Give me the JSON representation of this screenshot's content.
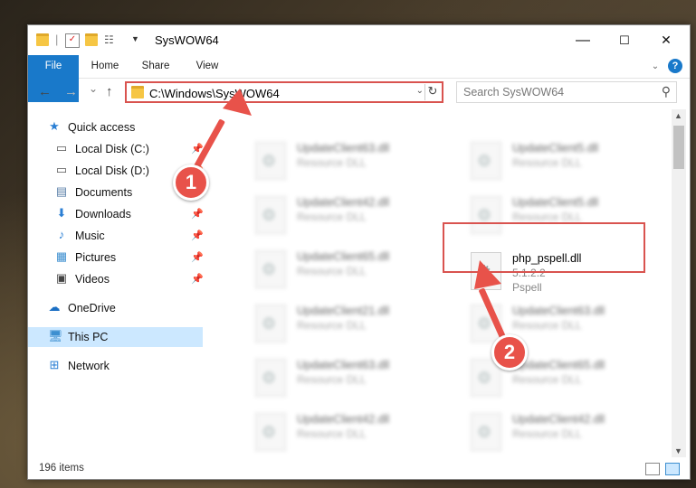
{
  "window": {
    "title": "SysWOW64",
    "minimize": "—",
    "maximize": "☐",
    "close": "✕"
  },
  "ribbon": {
    "tabs": [
      "File",
      "Home",
      "Share",
      "View"
    ],
    "help": "?"
  },
  "nav": {
    "back": "←",
    "forward": "→",
    "recent": "⌄",
    "up": "↑",
    "address": "C:\\Windows\\SysWOW64",
    "refresh": "↻",
    "search_placeholder": "Search SysWOW64",
    "search_icon": "⚲"
  },
  "sidebar": {
    "items": [
      {
        "label": "Quick access",
        "icon": "star-icon",
        "glyph": "★",
        "color": "#2b7fd4",
        "pinned": false
      },
      {
        "label": "Local Disk (C:)",
        "icon": "drive-icon",
        "glyph": "▭",
        "color": "#555",
        "pinned": true
      },
      {
        "label": "Local Disk (D:)",
        "icon": "drive-icon",
        "glyph": "▭",
        "color": "#555",
        "pinned": true
      },
      {
        "label": "Documents",
        "icon": "document-icon",
        "glyph": "▤",
        "color": "#5a7fa8",
        "pinned": true
      },
      {
        "label": "Downloads",
        "icon": "download-icon",
        "glyph": "⬇",
        "color": "#2b7fd4",
        "pinned": true
      },
      {
        "label": "Music",
        "icon": "music-icon",
        "glyph": "♪",
        "color": "#2b7fd4",
        "pinned": true
      },
      {
        "label": "Pictures",
        "icon": "pictures-icon",
        "glyph": "▦",
        "color": "#3d8fd0",
        "pinned": true
      },
      {
        "label": "Videos",
        "icon": "video-icon",
        "glyph": "▣",
        "color": "#444",
        "pinned": true
      },
      {
        "label": "OneDrive",
        "icon": "cloud-icon",
        "glyph": "☁",
        "color": "#1b6fc4",
        "pinned": false
      },
      {
        "label": "This PC",
        "icon": "computer-icon",
        "glyph": "🖥",
        "color": "#3d8fd0",
        "pinned": false
      },
      {
        "label": "Network",
        "icon": "network-icon",
        "glyph": "⊞",
        "color": "#2b7fd4",
        "pinned": false
      }
    ],
    "pin_glyph": "📌"
  },
  "files": {
    "left": [
      {
        "name": "UpdateClient63.dll",
        "type": "Resource DLL"
      },
      {
        "name": "UpdateClient42.dll",
        "type": "Resource DLL"
      },
      {
        "name": "UpdateClient65.dll",
        "type": "Resource DLL"
      },
      {
        "name": "UpdateClient21.dll",
        "type": "Resource DLL"
      },
      {
        "name": "UpdateClient63.dll",
        "type": "Resource DLL"
      },
      {
        "name": "UpdateClient42.dll",
        "type": "Resource DLL"
      }
    ],
    "right": [
      {
        "name": "UpdateClient5.dll",
        "type": "Resource DLL"
      },
      {
        "name": "UpdateClient5.dll",
        "type": "Resource DLL"
      },
      {
        "name": "UpdateClient63.dll",
        "type": "Resource DLL"
      },
      {
        "name": "UpdateClient65.dll",
        "type": "Resource DLL"
      },
      {
        "name": "UpdateClient42.dll",
        "type": "Resource DLL"
      }
    ],
    "highlighted": {
      "name": "php_pspell.dll",
      "version": "5.1.2.2",
      "description": "Pspell"
    }
  },
  "status": {
    "items_count": "196 items"
  },
  "annotations": {
    "step1": "1",
    "step2": "2",
    "color": "#e8524a"
  }
}
